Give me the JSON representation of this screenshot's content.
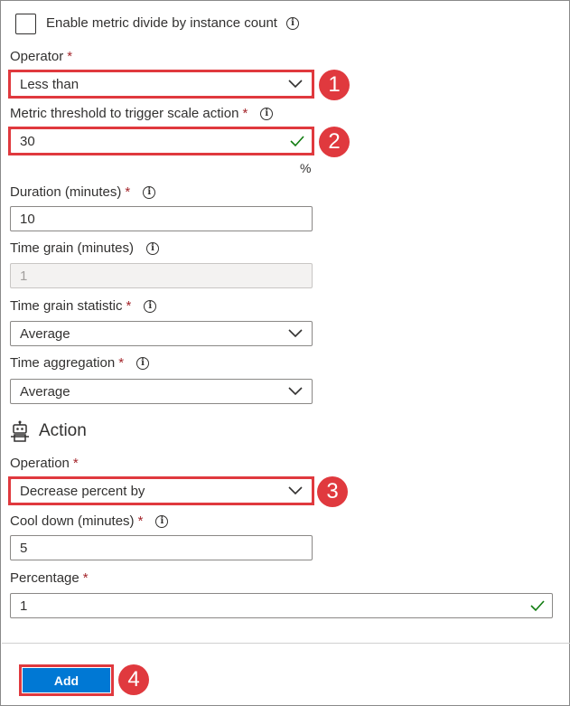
{
  "metric_divide": {
    "label": "Enable metric divide by instance count",
    "checked": false
  },
  "operator": {
    "label": "Operator",
    "required": "*",
    "value": "Less than"
  },
  "threshold": {
    "label": "Metric threshold to trigger scale action",
    "required": "*",
    "value": "30",
    "unit": "%"
  },
  "duration": {
    "label": "Duration (minutes)",
    "required": "*",
    "value": "10"
  },
  "time_grain": {
    "label": "Time grain (minutes)",
    "value": "1"
  },
  "time_grain_statistic": {
    "label": "Time grain statistic",
    "required": "*",
    "value": "Average"
  },
  "time_aggregation": {
    "label": "Time aggregation",
    "required": "*",
    "value": "Average"
  },
  "action_section": {
    "title": "Action",
    "icon": "robot-icon"
  },
  "operation": {
    "label": "Operation",
    "required": "*",
    "value": "Decrease percent by"
  },
  "cool_down": {
    "label": "Cool down (minutes)",
    "required": "*",
    "value": "5"
  },
  "percentage": {
    "label": "Percentage",
    "required": "*",
    "value": "1"
  },
  "add_button": {
    "label": "Add"
  },
  "callouts": {
    "one": "1",
    "two": "2",
    "three": "3",
    "four": "4"
  },
  "colors": {
    "highlight": "#e0393e",
    "primary": "#0078d4",
    "required": "#a4262c",
    "valid": "#107c10"
  },
  "info_glyph": "i"
}
